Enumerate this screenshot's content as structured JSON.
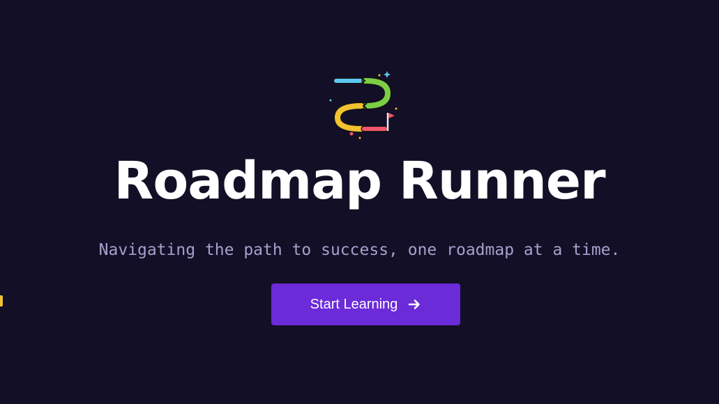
{
  "hero": {
    "logo_icon": "roadmap-path-icon",
    "title": "Roadmap Runner",
    "subtitle": "Navigating the path to success, one roadmap at a time.",
    "cta_label": "Start Learning",
    "cta_icon": "arrow-right-icon"
  },
  "colors": {
    "background": "#130f26",
    "title": "#ffffff",
    "subtitle": "#a6a1cc",
    "cta_background": "#6b2bd9",
    "logo_blue": "#5cc8f0",
    "logo_green": "#7ccf45",
    "logo_yellow": "#f2c230",
    "logo_red": "#f0566a"
  }
}
